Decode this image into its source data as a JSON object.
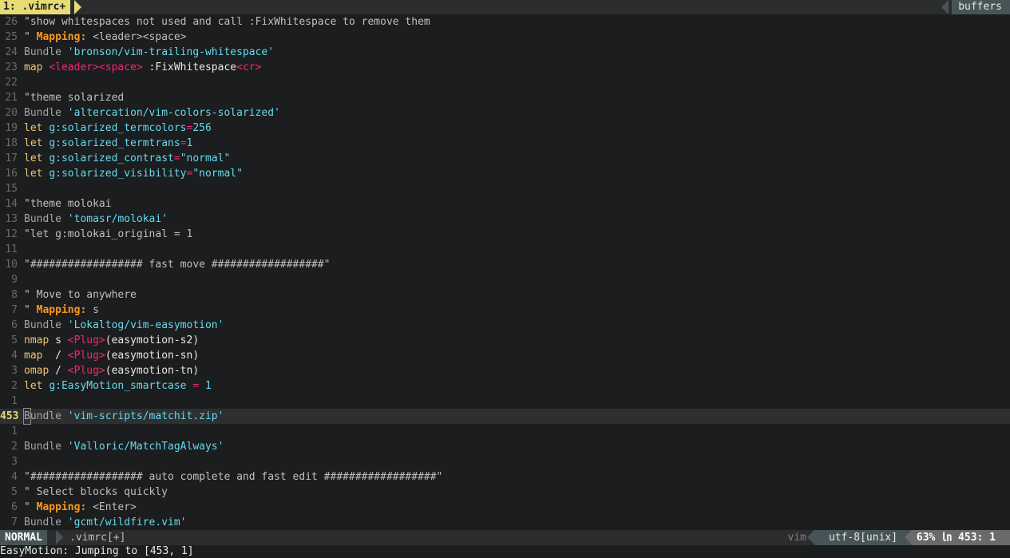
{
  "tabline": {
    "active_tab": "1: .vimrc+",
    "right_label": "buffers"
  },
  "colors": {
    "background": "#1b1d1e",
    "accent_yellow": "#e6db74",
    "string_cyan": "#66d9ef",
    "keyword_red": "#f92672",
    "mapping_orange": "#fd971f"
  },
  "lines": [
    {
      "num": "26",
      "tokens": [
        {
          "t": "\"show whitespaces not used and call :FixWhitespace to remove them",
          "c": "c-comment"
        }
      ]
    },
    {
      "num": "25",
      "tokens": [
        {
          "t": "\" ",
          "c": "c-comment"
        },
        {
          "t": "Mapping:",
          "c": "c-map-label"
        },
        {
          "t": " <leader><space>",
          "c": "c-comment"
        }
      ]
    },
    {
      "num": "24",
      "tokens": [
        {
          "t": "Bundle ",
          "c": "c-bundle"
        },
        {
          "t": "'bronson/vim-trailing-whitespace'",
          "c": "c-str"
        }
      ]
    },
    {
      "num": "23",
      "tokens": [
        {
          "t": "map ",
          "c": "c-let"
        },
        {
          "t": "<leader><space>",
          "c": "c-mapkey"
        },
        {
          "t": " :FixWhitespace",
          "c": "c-plain"
        },
        {
          "t": "<cr>",
          "c": "c-mapkey"
        }
      ]
    },
    {
      "num": "22",
      "tokens": []
    },
    {
      "num": "21",
      "tokens": [
        {
          "t": "\"theme solarized",
          "c": "c-comment"
        }
      ]
    },
    {
      "num": "20",
      "tokens": [
        {
          "t": "Bundle ",
          "c": "c-bundle"
        },
        {
          "t": "'altercation/vim-colors-solarized'",
          "c": "c-str"
        }
      ]
    },
    {
      "num": "19",
      "tokens": [
        {
          "t": "let ",
          "c": "c-let"
        },
        {
          "t": "g:solarized_termcolors",
          "c": "c-var"
        },
        {
          "t": "=",
          "c": "c-op"
        },
        {
          "t": "256",
          "c": "c-str"
        }
      ]
    },
    {
      "num": "18",
      "tokens": [
        {
          "t": "let ",
          "c": "c-let"
        },
        {
          "t": "g:solarized_termtrans",
          "c": "c-var"
        },
        {
          "t": "=",
          "c": "c-op"
        },
        {
          "t": "1",
          "c": "c-str"
        }
      ]
    },
    {
      "num": "17",
      "tokens": [
        {
          "t": "let ",
          "c": "c-let"
        },
        {
          "t": "g:solarized_contrast",
          "c": "c-var"
        },
        {
          "t": "=",
          "c": "c-op"
        },
        {
          "t": "\"normal\"",
          "c": "c-str"
        }
      ]
    },
    {
      "num": "16",
      "tokens": [
        {
          "t": "let ",
          "c": "c-let"
        },
        {
          "t": "g:solarized_visibility",
          "c": "c-var"
        },
        {
          "t": "=",
          "c": "c-op"
        },
        {
          "t": "\"normal\"",
          "c": "c-str"
        }
      ]
    },
    {
      "num": "15",
      "tokens": []
    },
    {
      "num": "14",
      "tokens": [
        {
          "t": "\"theme molokai",
          "c": "c-comment"
        }
      ]
    },
    {
      "num": "13",
      "tokens": [
        {
          "t": "Bundle ",
          "c": "c-bundle"
        },
        {
          "t": "'tomasr/molokai'",
          "c": "c-str"
        }
      ]
    },
    {
      "num": "12",
      "tokens": [
        {
          "t": "\"let g:molokai_original = 1",
          "c": "c-comment"
        }
      ]
    },
    {
      "num": "11",
      "tokens": []
    },
    {
      "num": "10",
      "tokens": [
        {
          "t": "\"################## fast move ##################\"",
          "c": "c-comment"
        }
      ]
    },
    {
      "num": "9",
      "tokens": []
    },
    {
      "num": "8",
      "tokens": [
        {
          "t": "\" Move to anywhere",
          "c": "c-comment"
        }
      ]
    },
    {
      "num": "7",
      "tokens": [
        {
          "t": "\" ",
          "c": "c-comment"
        },
        {
          "t": "Mapping:",
          "c": "c-map-label"
        },
        {
          "t": " s",
          "c": "c-comment"
        }
      ]
    },
    {
      "num": "6",
      "tokens": [
        {
          "t": "Bundle ",
          "c": "c-bundle"
        },
        {
          "t": "'Lokaltog/vim-easymotion'",
          "c": "c-str"
        }
      ]
    },
    {
      "num": "5",
      "tokens": [
        {
          "t": "nmap ",
          "c": "c-let"
        },
        {
          "t": "s ",
          "c": "c-plain"
        },
        {
          "t": "<Plug>",
          "c": "c-mapkey"
        },
        {
          "t": "(easymotion-s2)",
          "c": "c-plain"
        }
      ]
    },
    {
      "num": "4",
      "tokens": [
        {
          "t": "map ",
          "c": "c-let"
        },
        {
          "t": " / ",
          "c": "c-plain"
        },
        {
          "t": "<Plug>",
          "c": "c-mapkey"
        },
        {
          "t": "(easymotion-sn)",
          "c": "c-plain"
        }
      ]
    },
    {
      "num": "3",
      "tokens": [
        {
          "t": "omap ",
          "c": "c-let"
        },
        {
          "t": "/ ",
          "c": "c-plain"
        },
        {
          "t": "<Plug>",
          "c": "c-mapkey"
        },
        {
          "t": "(easymotion-tn)",
          "c": "c-plain"
        }
      ]
    },
    {
      "num": "2",
      "tokens": [
        {
          "t": "let ",
          "c": "c-let"
        },
        {
          "t": "g:EasyMotion_smartcase",
          "c": "c-var"
        },
        {
          "t": " = ",
          "c": "c-op"
        },
        {
          "t": "1",
          "c": "c-str"
        }
      ]
    },
    {
      "num": "1",
      "tokens": []
    },
    {
      "num": "453",
      "current": true,
      "tokens": [
        {
          "t": "B",
          "c": "c-bundle cursor"
        },
        {
          "t": "undle ",
          "c": "c-bundle"
        },
        {
          "t": "'vim-scripts/matchit.zip'",
          "c": "c-str"
        }
      ]
    },
    {
      "num": "1",
      "tokens": []
    },
    {
      "num": "2",
      "tokens": [
        {
          "t": "Bundle ",
          "c": "c-bundle"
        },
        {
          "t": "'Valloric/MatchTagAlways'",
          "c": "c-str"
        }
      ]
    },
    {
      "num": "3",
      "tokens": []
    },
    {
      "num": "4",
      "tokens": [
        {
          "t": "\"################## auto complete and fast edit ##################\"",
          "c": "c-comment"
        }
      ]
    },
    {
      "num": "5",
      "tokens": [
        {
          "t": "\" Select blocks quickly",
          "c": "c-comment"
        }
      ]
    },
    {
      "num": "6",
      "tokens": [
        {
          "t": "\" ",
          "c": "c-comment"
        },
        {
          "t": "Mapping:",
          "c": "c-map-label"
        },
        {
          "t": " <Enter>",
          "c": "c-comment"
        }
      ]
    },
    {
      "num": "7",
      "tokens": [
        {
          "t": "Bundle ",
          "c": "c-bundle"
        },
        {
          "t": "'gcmt/wildfire.vim'",
          "c": "c-str"
        }
      ]
    }
  ],
  "statusline": {
    "mode": "NORMAL",
    "filename": ".vimrc[+]",
    "filetype": "vim",
    "encoding": "utf-8[unix]",
    "position": "63% ㏑ 453:  1"
  },
  "cmdline": {
    "message": "EasyMotion: Jumping to [453, 1]"
  }
}
